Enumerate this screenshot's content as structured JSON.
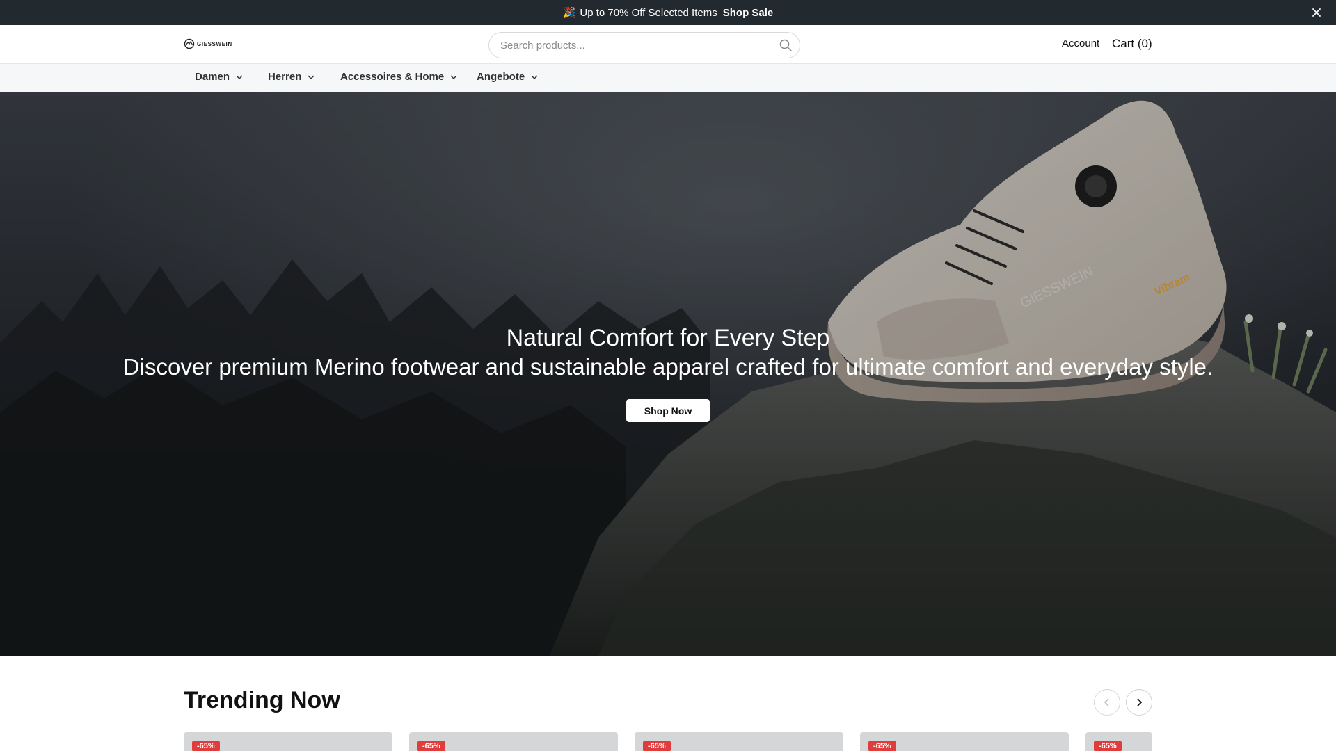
{
  "announcement": {
    "emoji": "🎉",
    "text": "Up to 70% Off Selected Items",
    "link_label": "Shop Sale",
    "close_icon": "close-icon"
  },
  "header": {
    "logo_text": "GIESSWEIN",
    "search_placeholder": "Search products...",
    "search_icon": "search-icon",
    "account_label": "Account",
    "cart_label": "Cart (0)"
  },
  "nav": {
    "items": [
      {
        "label": "Damen"
      },
      {
        "label": "Herren"
      },
      {
        "label": "Accessoires & Home"
      },
      {
        "label": "Angebote"
      }
    ],
    "chevron_icon": "chevron-down-icon"
  },
  "hero": {
    "title": "Natural Comfort for Every Step",
    "subtitle": "Discover premium Merino footwear and sustainable apparel crafted for ultimate comfort and everyday style.",
    "cta_label": "Shop Now",
    "shoe_brand": "GIESSWEIN",
    "sole_brand": "Vibram"
  },
  "trending": {
    "title": "Trending Now",
    "prev_icon": "chevron-left-icon",
    "next_icon": "chevron-right-icon",
    "cards": [
      {
        "badge": "-65%"
      },
      {
        "badge": "-65%"
      },
      {
        "badge": "-65%"
      },
      {
        "badge": "-65%"
      },
      {
        "badge": "-65%"
      }
    ]
  },
  "colors": {
    "announce_bg": "#222a30",
    "nav_bg": "#f6f7f8",
    "badge": "#e03c3c"
  }
}
